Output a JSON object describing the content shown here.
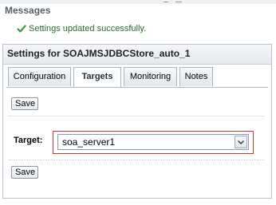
{
  "messages": {
    "title": "Messages",
    "success_text": "Settings updated successfully.",
    "icon": "check-icon"
  },
  "panel": {
    "title": "Settings for SOAJMSJDBCStore_auto_1"
  },
  "tabs": [
    {
      "label": "Configuration",
      "active": false
    },
    {
      "label": "Targets",
      "active": true
    },
    {
      "label": "Monitoring",
      "active": false
    },
    {
      "label": "Notes",
      "active": false
    }
  ],
  "form": {
    "save_label_top": "Save",
    "save_label_bottom": "Save",
    "target_label": "Target:",
    "target_value": "soa_server1",
    "target_options": [
      "soa_server1"
    ]
  },
  "colors": {
    "success": "#2b6a2b",
    "highlight_frame": "#c8343a",
    "panel_border": "#b9c4cf"
  }
}
